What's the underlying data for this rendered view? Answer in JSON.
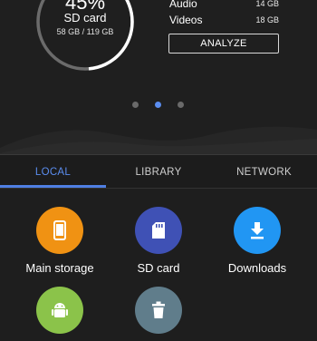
{
  "storage_card": {
    "percent": "45%",
    "name": "SD card",
    "usage": "58 GB / 119 GB",
    "used_fraction": 0.487
  },
  "breakdown": [
    {
      "label": "Audio",
      "value": "14 GB"
    },
    {
      "label": "Videos",
      "value": "18 GB"
    }
  ],
  "analyze_label": "ANALYZE",
  "pager": {
    "count": 3,
    "active_index": 1
  },
  "tabs": [
    {
      "label": "LOCAL",
      "active": true
    },
    {
      "label": "LIBRARY",
      "active": false
    },
    {
      "label": "NETWORK",
      "active": false
    }
  ],
  "locations": [
    {
      "label": "Main storage",
      "icon": "phone-icon",
      "color": "#f09213"
    },
    {
      "label": "SD card",
      "icon": "sd-card-icon",
      "color": "#3f51b5"
    },
    {
      "label": "Downloads",
      "icon": "download-icon",
      "color": "#2196f3"
    },
    {
      "label": "",
      "icon": "android-icon",
      "color": "#8bc34a"
    },
    {
      "label": "",
      "icon": "trash-icon",
      "color": "#607d8b"
    }
  ],
  "colors": {
    "accent": "#5b8def",
    "background": "#1e1e1e",
    "ring_used": "#ffffff",
    "ring_free": "#6b6b6b"
  }
}
